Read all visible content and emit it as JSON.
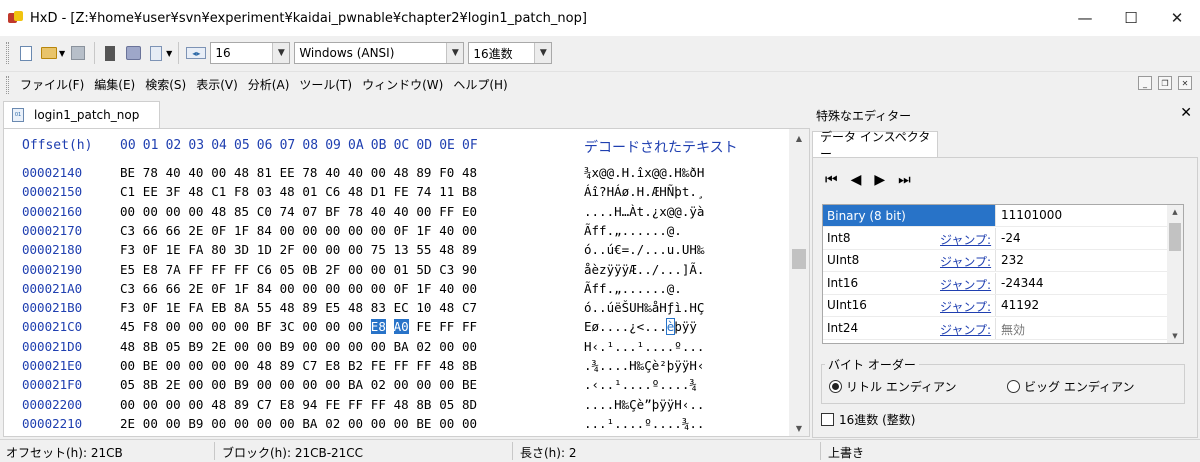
{
  "window": {
    "title": "HxD - [Z:¥home¥user¥svn¥experiment¥kaidai_pwnable¥chapter2¥login1_patch_nop]",
    "minimize": "—",
    "maximize": "☐",
    "close": "✕"
  },
  "toolbar": {
    "columns_value": "16",
    "encoding_value": "Windows (ANSI)",
    "base_value": "16進数"
  },
  "menu": {
    "items": [
      "ファイル(F)",
      "編集(E)",
      "検索(S)",
      "表示(V)",
      "分析(A)",
      "ツール(T)",
      "ウィンドウ(W)",
      "ヘルプ(H)"
    ]
  },
  "tab": {
    "label": "login1_patch_nop"
  },
  "hex": {
    "offset_header": "Offset(h)",
    "columns": [
      "00",
      "01",
      "02",
      "03",
      "04",
      "05",
      "06",
      "07",
      "08",
      "09",
      "0A",
      "0B",
      "0C",
      "0D",
      "0E",
      "0F"
    ],
    "decoded_header": "デコードされたテキスト",
    "rows": [
      {
        "offset": "00002140",
        "bytes": [
          "BE",
          "78",
          "40",
          "40",
          "00",
          "48",
          "81",
          "EE",
          "78",
          "40",
          "40",
          "00",
          "48",
          "89",
          "F0",
          "48"
        ],
        "text": "¾x@@.H.îx@@.H‰ðH"
      },
      {
        "offset": "00002150",
        "bytes": [
          "C1",
          "EE",
          "3F",
          "48",
          "C1",
          "F8",
          "03",
          "48",
          "01",
          "C6",
          "48",
          "D1",
          "FE",
          "74",
          "11",
          "B8"
        ],
        "text": "Áî?HÁø.H.ÆHÑþt.¸"
      },
      {
        "offset": "00002160",
        "bytes": [
          "00",
          "00",
          "00",
          "00",
          "48",
          "85",
          "C0",
          "74",
          "07",
          "BF",
          "78",
          "40",
          "40",
          "00",
          "FF",
          "E0"
        ],
        "text": "....H…Àt.¿x@@.ÿà"
      },
      {
        "offset": "00002170",
        "bytes": [
          "C3",
          "66",
          "66",
          "2E",
          "0F",
          "1F",
          "84",
          "00",
          "00",
          "00",
          "00",
          "00",
          "0F",
          "1F",
          "40",
          "00"
        ],
        "text": "Ãff.„......@."
      },
      {
        "offset": "00002180",
        "bytes": [
          "F3",
          "0F",
          "1E",
          "FA",
          "80",
          "3D",
          "1D",
          "2F",
          "00",
          "00",
          "00",
          "75",
          "13",
          "55",
          "48",
          "89"
        ],
        "text": "ó..ú€=./...u.UH‰"
      },
      {
        "offset": "00002190",
        "bytes": [
          "E5",
          "E8",
          "7A",
          "FF",
          "FF",
          "FF",
          "C6",
          "05",
          "0B",
          "2F",
          "00",
          "00",
          "01",
          "5D",
          "C3",
          "90"
        ],
        "text": "åèzÿÿÿÆ../...]Ã."
      },
      {
        "offset": "000021A0",
        "bytes": [
          "C3",
          "66",
          "66",
          "2E",
          "0F",
          "1F",
          "84",
          "00",
          "00",
          "00",
          "00",
          "00",
          "0F",
          "1F",
          "40",
          "00"
        ],
        "text": "Ãff.„......@."
      },
      {
        "offset": "000021B0",
        "bytes": [
          "F3",
          "0F",
          "1E",
          "FA",
          "EB",
          "8A",
          "55",
          "48",
          "89",
          "E5",
          "48",
          "83",
          "EC",
          "10",
          "48",
          "C7"
        ],
        "text": "ó..úëŠUH‰åHƒì.HÇ"
      },
      {
        "offset": "000021C0",
        "bytes": [
          "45",
          "F8",
          "00",
          "00",
          "00",
          "00",
          "BF",
          "3C",
          "00",
          "00",
          "00",
          "E8",
          "A0",
          "FE",
          "FF",
          "FF"
        ],
        "text_pre": "Eø....¿<...",
        "text_sel": "è",
        "text_post": "þÿÿ"
      },
      {
        "offset": "000021D0",
        "bytes": [
          "48",
          "8B",
          "05",
          "B9",
          "2E",
          "00",
          "00",
          "B9",
          "00",
          "00",
          "00",
          "00",
          "BA",
          "02",
          "00",
          "00"
        ],
        "text": "H‹.¹...¹....º..."
      },
      {
        "offset": "000021E0",
        "bytes": [
          "00",
          "BE",
          "00",
          "00",
          "00",
          "00",
          "48",
          "89",
          "C7",
          "E8",
          "B2",
          "FE",
          "FF",
          "FF",
          "48",
          "8B"
        ],
        "text": ".¾....H‰Çè²þÿÿH‹"
      },
      {
        "offset": "000021F0",
        "bytes": [
          "05",
          "8B",
          "2E",
          "00",
          "00",
          "B9",
          "00",
          "00",
          "00",
          "00",
          "BA",
          "02",
          "00",
          "00",
          "00",
          "BE"
        ],
        "text": ".‹..¹....º....¾"
      },
      {
        "offset": "00002200",
        "bytes": [
          "00",
          "00",
          "00",
          "00",
          "48",
          "89",
          "C7",
          "E8",
          "94",
          "FE",
          "FF",
          "FF",
          "48",
          "8B",
          "05",
          "8D"
        ],
        "text": "....H‰Çè”þÿÿH‹.."
      },
      {
        "offset": "00002210",
        "bytes": [
          "2E",
          "00",
          "00",
          "B9",
          "00",
          "00",
          "00",
          "00",
          "BA",
          "02",
          "00",
          "00",
          "00",
          "BE",
          "00",
          "00"
        ],
        "text": "...¹....º....¾.."
      }
    ]
  },
  "inspector": {
    "panel_title": "特殊なエディター",
    "panel_close": "✕",
    "tab_label": "データ インスペクター",
    "nav": [
      "⏮",
      "◀",
      "▶",
      "⏭"
    ],
    "rows": [
      {
        "name": "Binary (8 bit)",
        "jump": "",
        "value": "11101000"
      },
      {
        "name": "Int8",
        "jump": "ジャンプ:",
        "value": "-24"
      },
      {
        "name": "UInt8",
        "jump": "ジャンプ:",
        "value": "232"
      },
      {
        "name": "Int16",
        "jump": "ジャンプ:",
        "value": "-24344"
      },
      {
        "name": "UInt16",
        "jump": "ジャンプ:",
        "value": "41192"
      },
      {
        "name": "Int24",
        "jump": "ジャンプ:",
        "value": "無効"
      }
    ],
    "byte_order_label": "バイト オーダー",
    "little_endian": "リトル エンディアン",
    "big_endian": "ビッグ エンディアン",
    "hex_checkbox": "16進数 (整数)"
  },
  "status": {
    "offset": "オフセット(h): 21CB",
    "block": "ブロック(h): 21CB-21CC",
    "length": "長さ(h): 2",
    "mode": "上書き"
  },
  "colors": {
    "accent": "#2873c8",
    "offset_blue": "#1f3fb0"
  }
}
